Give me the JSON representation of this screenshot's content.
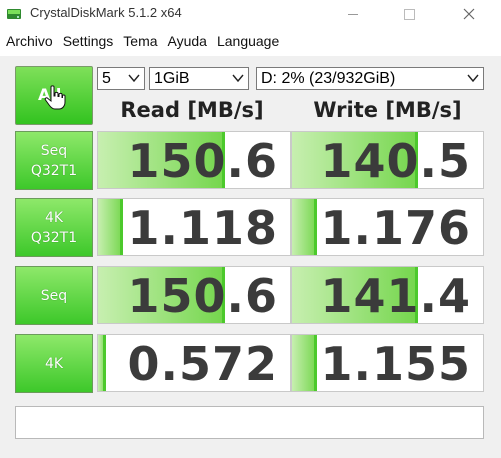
{
  "window": {
    "title": "CrystalDiskMark 5.1.2 x64",
    "controls": {
      "minimize": "—",
      "maximize": "☐",
      "close": "✕"
    }
  },
  "menu": [
    "Archivo",
    "Settings",
    "Tema",
    "Ayuda",
    "Language"
  ],
  "controls": {
    "all_button_label": "All",
    "count": "5",
    "size": "1GiB",
    "drive": "D: 2% (23/932GiB)"
  },
  "headers": {
    "read": "Read [MB/s]",
    "write": "Write [MB/s]"
  },
  "rows": [
    {
      "label_line1": "Seq",
      "label_line2": "Q32T1",
      "read": "150.6",
      "write": "140.5",
      "read_fill": 0.66,
      "write_fill": 0.66
    },
    {
      "label_line1": "4K",
      "label_line2": "Q32T1",
      "read": "1.118",
      "write": "1.176",
      "read_fill": 0.13,
      "write_fill": 0.13
    },
    {
      "label_line1": "Seq",
      "label_line2": "",
      "read": "150.6",
      "write": "141.4",
      "read_fill": 0.66,
      "write_fill": 0.66
    },
    {
      "label_line1": "4K",
      "label_line2": "",
      "read": "0.572",
      "write": "1.155",
      "read_fill": 0.04,
      "write_fill": 0.13
    }
  ],
  "comment": "",
  "colors": {
    "accent_green": "#3dc82a",
    "bar_green": "#74d64c",
    "panel_bg": "#f0f0f0"
  },
  "icons": {
    "app": "crystaldiskmark-disk-icon",
    "cursor": "hand-pointer-icon"
  }
}
